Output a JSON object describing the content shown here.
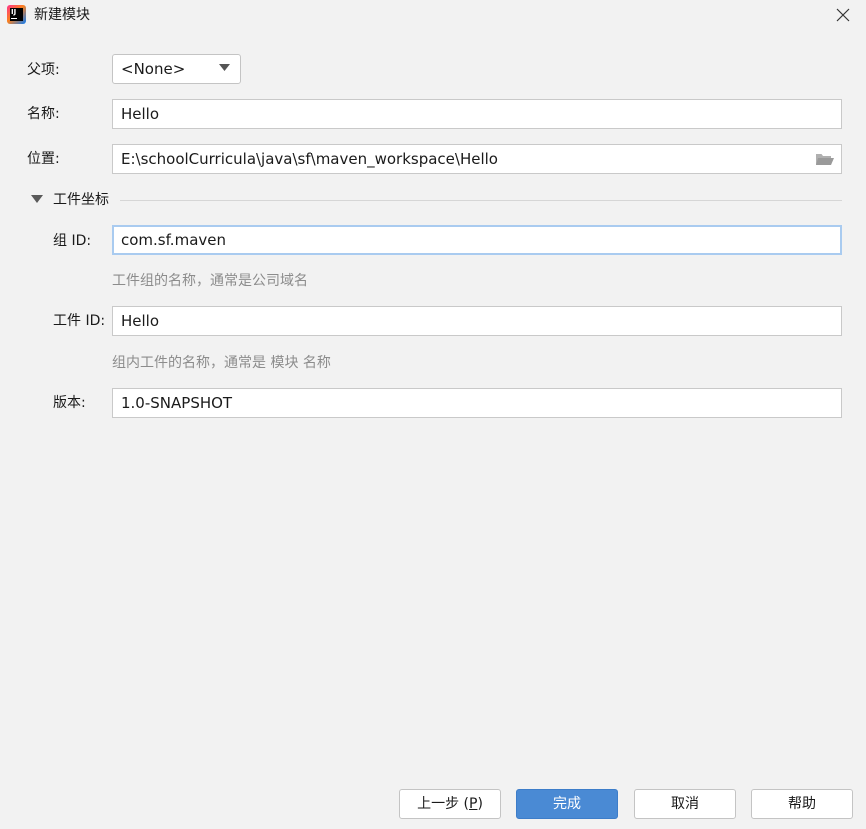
{
  "window": {
    "title": "新建模块",
    "app_icon_text": "IJ"
  },
  "form": {
    "parent_label": "父项:",
    "parent_value": "<None>",
    "name_label": "名称:",
    "name_value": "Hello",
    "location_label": "位置:",
    "location_value": "E:\\schoolCurricula\\java\\sf\\maven_workspace\\Hello"
  },
  "artifact_section": {
    "title": "工件坐标",
    "group_label": "组 ID:",
    "group_value": "com.sf.maven",
    "group_hint": "工件组的名称，通常是公司域名",
    "artifact_label": "工件 ID:",
    "artifact_value": "Hello",
    "artifact_hint": "组内工件的名称，通常是 模块 名称",
    "version_label": "版本:",
    "version_value": "1.0-SNAPSHOT"
  },
  "buttons": {
    "prev_prefix": "上一步 (",
    "prev_mnemonic": "P",
    "prev_suffix": ")",
    "finish": "完成",
    "cancel": "取消",
    "help": "帮助"
  },
  "icons": {
    "app": "intellij-idea-icon",
    "close": "close-icon",
    "dropdown": "chevron-down-icon",
    "browse": "folder-open-icon",
    "section_toggle": "triangle-down-icon"
  },
  "colors": {
    "background": "#f2f2f2",
    "primary_button": "#4a8ad4",
    "focus_border": "#a9cbf0",
    "hint_text": "#8c8c8c"
  }
}
